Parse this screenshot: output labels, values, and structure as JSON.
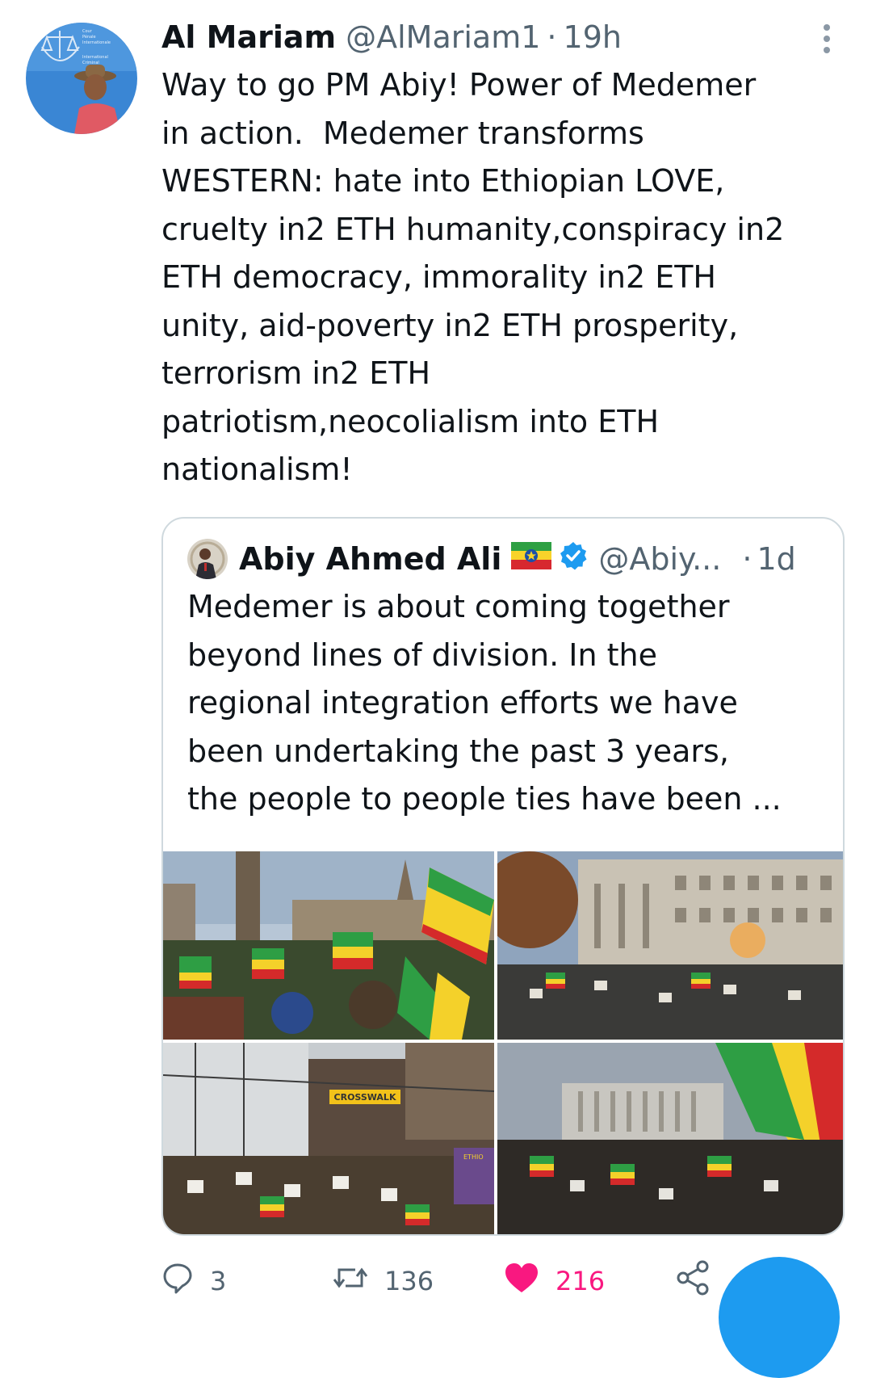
{
  "tweet": {
    "author_name": "Al Mariam",
    "author_handle": "@AlMariam1",
    "separator": "·",
    "time": "19h",
    "text": "Way to go PM Abiy! Power of Medemer\nin action.  Medemer transforms\nWESTERN: hate into Ethiopian LOVE,\ncruelty in2 ETH humanity,conspiracy in2\nETH democracy, immorality in2 ETH\nunity, aid-poverty in2 ETH prosperity,\nterrorism in2 ETH\npatriotism,neocolialism into ETH\nnationalism!",
    "avatar_badge_text": [
      "Cour",
      "Pénale",
      "Internationale",
      "International",
      "Criminal"
    ]
  },
  "quoted": {
    "author_name": "Abiy Ahmed Ali",
    "author_handle": "@Abiy...",
    "separator": "·",
    "time": "1d",
    "verified": true,
    "flag_icon": "ethiopia-flag-icon",
    "text": "Medemer is about coming together\nbeyond lines of division. In the\nregional integration efforts we have\nbeen undertaking the past 3 years,\nthe people to people ties have been ...",
    "photos": [
      {
        "name": "photo-rally-parliament",
        "sign_text": ""
      },
      {
        "name": "photo-rally-government-building",
        "sign_text": ""
      },
      {
        "name": "photo-rally-street",
        "sign_text": "CROSSWALK",
        "banner_text": "ETHIO\nVOTE\nDEMO\nGOVE"
      },
      {
        "name": "photo-rally-plaza",
        "sign_text": ""
      }
    ]
  },
  "actions": {
    "reply_count": "3",
    "retweet_count": "136",
    "like_count": "216",
    "liked": true,
    "icons": [
      "reply-icon",
      "retweet-icon",
      "heart-icon",
      "share-icon"
    ]
  },
  "colors": {
    "text": "#0f1419",
    "secondary": "#536471",
    "border": "#cfd9de",
    "like": "#f91880",
    "accent": "#1d9bf0",
    "verified": "#1d9bf0"
  }
}
